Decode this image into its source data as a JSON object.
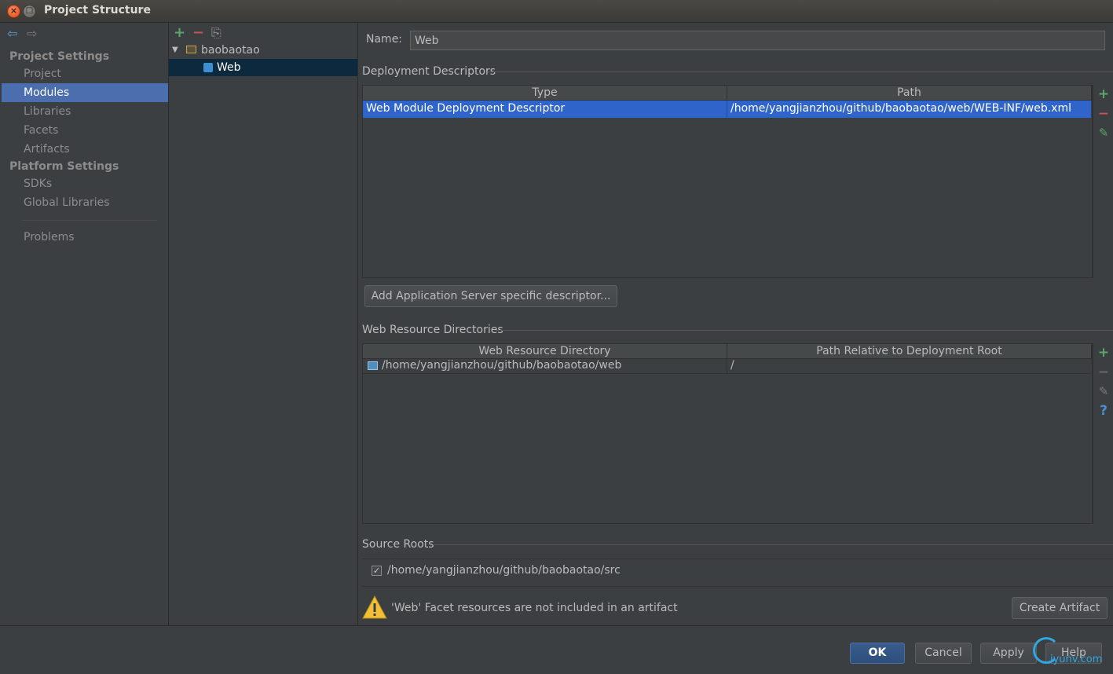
{
  "window": {
    "title": "Project Structure",
    "close_glyph": "×",
    "max_glyph": "□"
  },
  "nav": {
    "back": "⇦",
    "forward": "⇨"
  },
  "sidebar": {
    "project_settings_title": "Project Settings",
    "project_items": [
      {
        "label": "Project"
      },
      {
        "label": "Modules"
      },
      {
        "label": "Libraries"
      },
      {
        "label": "Facets"
      },
      {
        "label": "Artifacts"
      }
    ],
    "platform_settings_title": "Platform Settings",
    "platform_items": [
      {
        "label": "SDKs"
      },
      {
        "label": "Global Libraries"
      }
    ],
    "problems": "Problems",
    "selected": "Modules"
  },
  "tree": {
    "toolbar": {
      "add": "+",
      "remove": "−",
      "copy": "⎘"
    },
    "root": "baobaotao",
    "child": "Web"
  },
  "facet": {
    "name_label": "Name:",
    "name_value": "Web",
    "deployment": {
      "title": "Deployment Descriptors",
      "headers": [
        "Type",
        "Path"
      ],
      "rows": [
        {
          "type": "Web Module Deployment Descriptor",
          "path": "/home/yangjianzhou/github/baobaotao/web/WEB-INF/web.xml"
        }
      ],
      "add_server_button": "Add Application Server specific descriptor..."
    },
    "web_resources": {
      "title": "Web Resource Directories",
      "headers": [
        "Web Resource Directory",
        "Path Relative to Deployment Root"
      ],
      "rows": [
        {
          "dir": "/home/yangjianzhou/github/baobaotao/web",
          "rel": "/"
        }
      ]
    },
    "source_roots": {
      "title": "Source Roots",
      "items": [
        {
          "checked": true,
          "path": "/home/yangjianzhou/github/baobaotao/src"
        }
      ]
    },
    "warning": "'Web' Facet resources are not included in an artifact",
    "create_artifact_button": "Create Artifact"
  },
  "tools": {
    "add": "+",
    "remove": "−",
    "edit": "✎",
    "help": "?"
  },
  "footer": {
    "ok": "OK",
    "cancel": "Cancel",
    "apply": "Apply",
    "help": "Help"
  },
  "watermark": "iyunv.com",
  "colors": {
    "accent": "#4b6eaf",
    "selection": "#2f65ca",
    "add_green": "#59a869",
    "remove_red": "#c75450",
    "warning": "#f2c037"
  }
}
